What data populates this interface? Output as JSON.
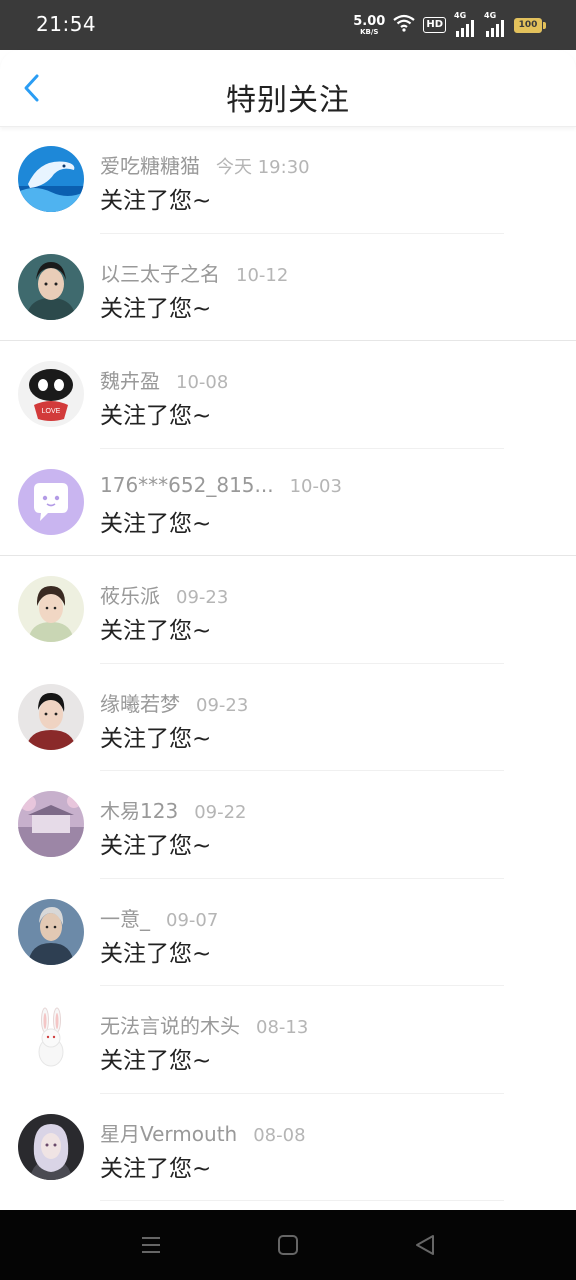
{
  "status": {
    "time": "21:54",
    "speed_value": "5.00",
    "speed_unit": "KB/S",
    "hd": "HD",
    "net1": "4G",
    "net2": "4G",
    "battery": "100"
  },
  "header": {
    "title": "特别关注",
    "back_icon": "chevron-left-icon",
    "accent": "#2a9df4"
  },
  "items": [
    {
      "name": "爱吃糖糖猫",
      "time": "今天 19:30",
      "message": "关注了您~",
      "avatar": "dolphin"
    },
    {
      "name": "以三太子之名",
      "time": "10-12",
      "message": "关注了您~",
      "avatar": "portrait"
    },
    {
      "name": "魏卉盈",
      "time": "10-08",
      "message": "关注了您~",
      "avatar": "cartoon-love"
    },
    {
      "name": "176***652_815...",
      "time": "10-03",
      "message": "关注了您~",
      "avatar": "chat-bubble"
    },
    {
      "name": "莜乐派",
      "time": "09-23",
      "message": "关注了您~",
      "avatar": "portrait"
    },
    {
      "name": "缘曦若梦",
      "time": "09-23",
      "message": "关注了您~",
      "avatar": "portrait"
    },
    {
      "name": "木易123",
      "time": "09-22",
      "message": "关注了您~",
      "avatar": "scenery"
    },
    {
      "name": "一意_",
      "time": "09-07",
      "message": "关注了您~",
      "avatar": "portrait"
    },
    {
      "name": "无法言说的木头",
      "time": "08-13",
      "message": "关注了您~",
      "avatar": "rabbit"
    },
    {
      "name": "星月Vermouth",
      "time": "08-08",
      "message": "关注了您~",
      "avatar": "portrait"
    }
  ],
  "nav": {
    "menu_icon": "menu-icon",
    "home_icon": "home-square-icon",
    "back_icon": "back-triangle-icon"
  }
}
